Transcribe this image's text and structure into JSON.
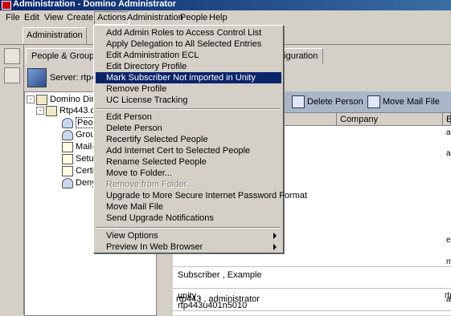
{
  "window": {
    "title": "Administration - Domino Administrator"
  },
  "menubar": {
    "items": [
      {
        "label": "File"
      },
      {
        "label": "Edit"
      },
      {
        "label": "View"
      },
      {
        "label": "Create"
      },
      {
        "label": "Actions"
      },
      {
        "label": "Administration"
      },
      {
        "label": "People"
      },
      {
        "label": "Help"
      }
    ]
  },
  "window_tab": {
    "label": "Administration"
  },
  "left_panel": {
    "tab_label": "People & Groups",
    "server_label": "Server: rtp44",
    "tree": [
      {
        "label": "Domino Dir"
      },
      {
        "label": "Rtp443.c"
      },
      {
        "label": "Peop"
      },
      {
        "label": "Grou"
      },
      {
        "label": "Mail-"
      },
      {
        "label": "Setu"
      },
      {
        "label": "Certi"
      },
      {
        "label": "Deny"
      }
    ]
  },
  "right_panel": {
    "tab_label": "nfiguration",
    "toolbar": {
      "delete_person": "Delete Person",
      "move_mail_file": "Move Mail File"
    },
    "columns": [
      "e",
      "Company",
      "E"
    ],
    "rows": [
      {
        "name": "rtp443 , administrator",
        "email": "ac"
      },
      {
        "name": "Subscriber , Example",
        "email": ""
      },
      {
        "name": "unity ,",
        "name2": "rtp443u401n5010",
        "email": "rtp"
      }
    ],
    "right_fragments": [
      "ac",
      "ac",
      "en",
      "m"
    ]
  },
  "actions_menu": {
    "items": [
      {
        "label": "Add Admin Roles to Access Control List",
        "enabled": true
      },
      {
        "label": "Apply Delegation to All Selected Entries",
        "enabled": true
      },
      {
        "label": "Edit Administration ECL",
        "enabled": true
      },
      {
        "label": "Edit Directory Profile",
        "enabled": true
      },
      {
        "label": "Mark Subscriber Not imported in Unity",
        "enabled": true,
        "highlighted": true
      },
      {
        "label": "Remove Profile",
        "enabled": true
      },
      {
        "label": "UC License Tracking",
        "enabled": true
      },
      {
        "separator": true
      },
      {
        "label": "Edit Person",
        "enabled": true
      },
      {
        "label": "Delete Person",
        "enabled": true
      },
      {
        "label": "Recertify Selected People",
        "enabled": true
      },
      {
        "label": "Add Internet Cert to Selected People",
        "enabled": true
      },
      {
        "label": "Rename Selected People",
        "enabled": true
      },
      {
        "label": "Move to Folder...",
        "enabled": true
      },
      {
        "label": "Remove from Folder...",
        "enabled": false
      },
      {
        "label": "Upgrade to More Secure Internet Password Format",
        "enabled": true
      },
      {
        "label": "Move Mail File",
        "enabled": true
      },
      {
        "label": "Send Upgrade Notifications",
        "enabled": true
      },
      {
        "separator": true
      },
      {
        "label": "View Options",
        "enabled": true,
        "submenu": true
      },
      {
        "label": "Preview In Web Browser",
        "enabled": true,
        "submenu": true
      }
    ]
  }
}
